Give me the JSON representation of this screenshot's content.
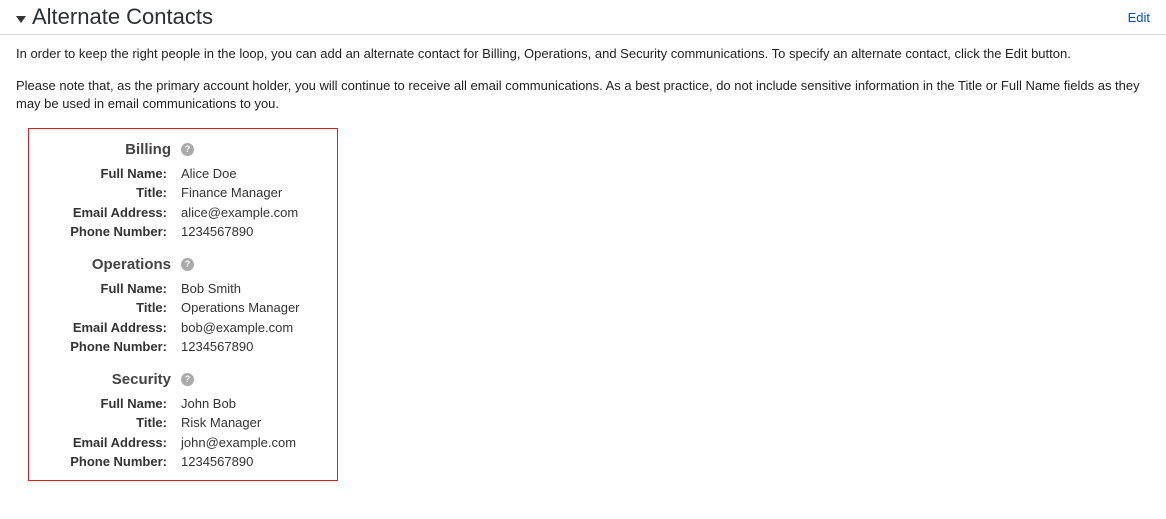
{
  "header": {
    "title": "Alternate Contacts",
    "edit_label": "Edit"
  },
  "description": {
    "para1": "In order to keep the right people in the loop, you can add an alternate contact for Billing, Operations, and Security communications. To specify an alternate contact, click the Edit button.",
    "para2": "Please note that, as the primary account holder, you will continue to receive all email communications. As a best practice, do not include sensitive information in the Title or Full Name fields as they may be used in email communications to you."
  },
  "field_labels": {
    "full_name": "Full Name:",
    "title": "Title:",
    "email": "Email Address:",
    "phone": "Phone Number:"
  },
  "help_glyph": "?",
  "contacts": {
    "billing": {
      "heading": "Billing",
      "full_name": "Alice Doe",
      "title": "Finance Manager",
      "email": "alice@example.com",
      "phone": "1234567890"
    },
    "operations": {
      "heading": "Operations",
      "full_name": "Bob Smith",
      "title": "Operations Manager",
      "email": "bob@example.com",
      "phone": "1234567890"
    },
    "security": {
      "heading": "Security",
      "full_name": "John Bob",
      "title": "Risk Manager",
      "email": "john@example.com",
      "phone": "1234567890"
    }
  }
}
